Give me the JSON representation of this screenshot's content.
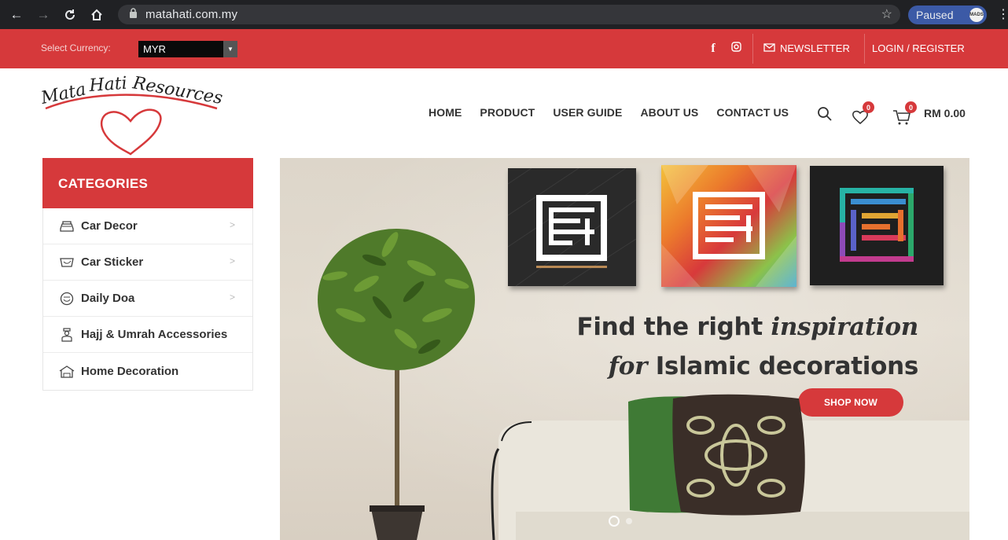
{
  "browser": {
    "url": "matahati.com.my",
    "profile_status": "Paused",
    "profile_avatar": "MADS"
  },
  "topbar": {
    "currency_label": "Select Currency:",
    "currency_value": "MYR",
    "newsletter": "NEWSLETTER",
    "login": "LOGIN / REGISTER",
    "social_icons": [
      "facebook-icon",
      "instagram-icon"
    ]
  },
  "header": {
    "logo_text": "Mata Hati Resources",
    "nav": [
      "HOME",
      "PRODUCT",
      "USER GUIDE",
      "ABOUT US",
      "CONTACT US"
    ],
    "wishlist_count": "0",
    "cart_count": "0",
    "cart_total": "RM 0.00"
  },
  "categories": {
    "title": "CATEGORIES",
    "items": [
      {
        "label": "Car Decor",
        "icon": "car-icon",
        "has_children": true
      },
      {
        "label": "Car Sticker",
        "icon": "sticker-icon",
        "has_children": true
      },
      {
        "label": "Daily Doa",
        "icon": "doa-icon",
        "has_children": true
      },
      {
        "label": "Hajj & Umrah Accessories",
        "icon": "pilgrim-icon",
        "has_children": false
      },
      {
        "label": "Home Decoration",
        "icon": "home-icon",
        "has_children": false
      }
    ]
  },
  "banner": {
    "line1_prefix": "Find the right",
    "line1_emph": "inspiration",
    "line2_emph": "for",
    "line2_suffix": "Islamic decorations",
    "cta": "SHOP NOW",
    "slides": 2,
    "active_slide": 1
  },
  "colors": {
    "brand_red": "#d6393b",
    "chrome_dark": "#202124"
  }
}
